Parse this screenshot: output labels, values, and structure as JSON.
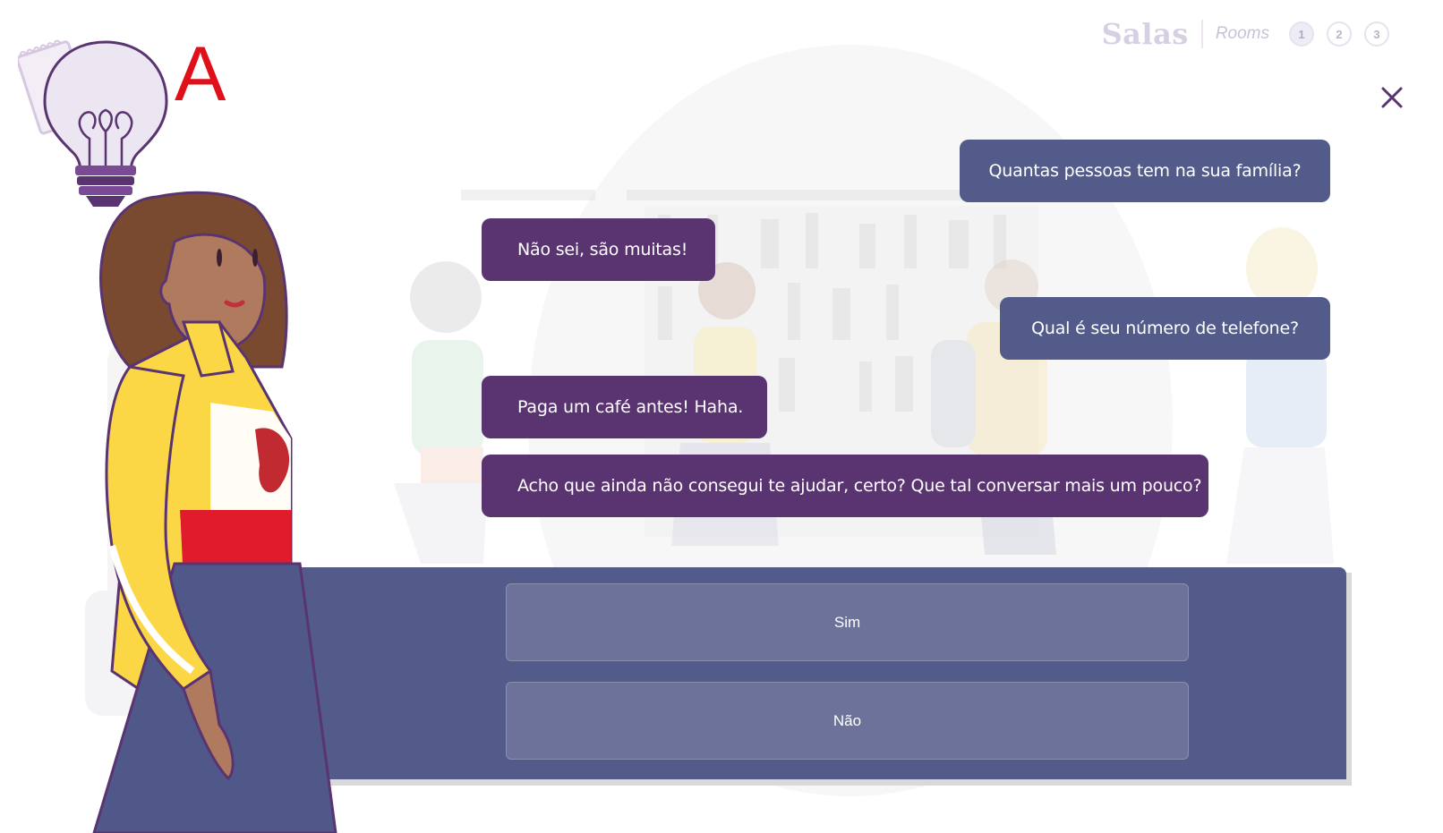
{
  "header": {
    "title": "Salas",
    "rooms_label": "Rooms",
    "rooms": [
      "1",
      "2",
      "3"
    ],
    "active_room": "1"
  },
  "hint": {
    "icon": "lightbulb-icon",
    "letter": "A"
  },
  "close": {
    "icon": "close-icon"
  },
  "chat": {
    "messages": [
      {
        "from": "user",
        "text": "Quantas pessoas tem na sua família?"
      },
      {
        "from": "bot",
        "text": "Não sei, são muitas!"
      },
      {
        "from": "user",
        "text": "Qual é seu número de telefone?"
      },
      {
        "from": "bot",
        "text": "Paga um café antes! Haha."
      },
      {
        "from": "bot",
        "text": "Acho que ainda não consegui te ajudar, certo? Que tal conversar mais um pouco?"
      }
    ]
  },
  "answers": {
    "options": [
      "Sim",
      "Não"
    ]
  },
  "colors": {
    "user_bubble": "#525b89",
    "bot_bubble": "#5a3470",
    "panel": "#525b89",
    "accent_red": "#e0101a"
  }
}
